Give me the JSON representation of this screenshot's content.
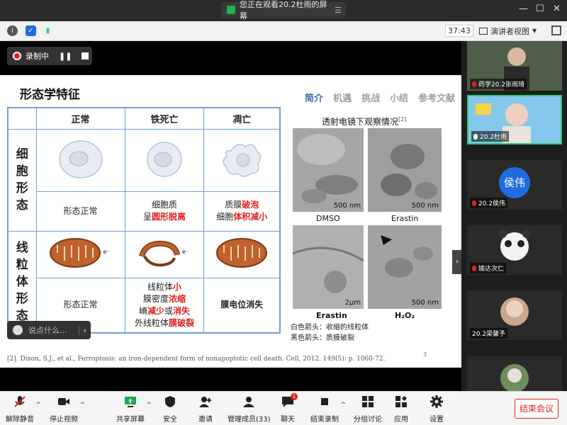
{
  "titlebar": {
    "share_notice": "您正在观看20.2杜雨的屏幕"
  },
  "toolbar": {
    "timer": "37:43",
    "view_mode": "演讲者视图"
  },
  "recording": {
    "label": "录制中"
  },
  "slide": {
    "title": "形态学特征",
    "nav_tabs": [
      "简介",
      "机遇",
      "挑战",
      "小结",
      "参考文献"
    ],
    "table": {
      "headers": [
        "正常",
        "铁死亡",
        "凋亡"
      ],
      "row_labels": [
        "细胞形态",
        "线粒体形态"
      ],
      "cell_desc": {
        "normal": "形态正常",
        "ferroptosis_a": "细胞质",
        "ferroptosis_b1": "呈",
        "ferroptosis_b2": "圆形脱离",
        "apoptosis_a1": "质膜",
        "apoptosis_a2": "破泡",
        "apoptosis_b1": "细胞",
        "apoptosis_b2": "体积减小"
      },
      "mito_desc": {
        "normal": "形态正常",
        "f1a": "线粒体",
        "f1b": "小",
        "f2a": "膜密度",
        "f2b": "浓缩",
        "f3a": "嵴",
        "f3b": "减少",
        "f3c": "或",
        "f3d": "消失",
        "f4a": "外线粒体",
        "f4b": "膜破裂",
        "apoptosis": "膜电位消失"
      },
      "electron_label": "e⁻"
    },
    "em": {
      "title": "透射电镜下观察情况",
      "ref": "[2]",
      "scale": "500 nm",
      "scale_short": "2μm",
      "labels": [
        "DMSO",
        "Erastin",
        "Erastin",
        "H₂O₂"
      ],
      "legend": [
        "白色箭头：收缩的线粒体",
        "黑色箭头：质膜破裂"
      ]
    },
    "citation": "[2]. Dixon, S.J., et al., Ferroptosis: an iron-dependent form of nonapoptotic cell death. Cell, 2012. 149(5): p. 1060-72.",
    "page_number": "3"
  },
  "chat": {
    "placeholder": "说点什么..."
  },
  "gallery": [
    {
      "name": "药学20.2张雨琦",
      "muted": true
    },
    {
      "name": "20.2杜雨",
      "muted": false
    },
    {
      "name": "20.2侯伟",
      "muted": true,
      "avatar_text": "侯伟"
    },
    {
      "name": "瑜达次仁",
      "muted": true
    },
    {
      "name": "20.2梁馨予",
      "muted": false
    },
    {
      "name": "",
      "muted": false
    }
  ],
  "bottom_bar": {
    "unmute": "解除静音",
    "stop_video": "停止视频",
    "share": "共享屏幕",
    "security": "安全",
    "invite": "邀请",
    "participants": "管理成员(33)",
    "chat": "聊天",
    "chat_badge": "1",
    "end_recording": "结束录制",
    "breakout": "分组讨论",
    "apps": "应用",
    "settings": "设置",
    "end_meeting": "结束会议"
  },
  "colors": {
    "accent_blue": "#3a6fb5",
    "danger_red": "#e02020",
    "active_green": "#2ecc71"
  }
}
